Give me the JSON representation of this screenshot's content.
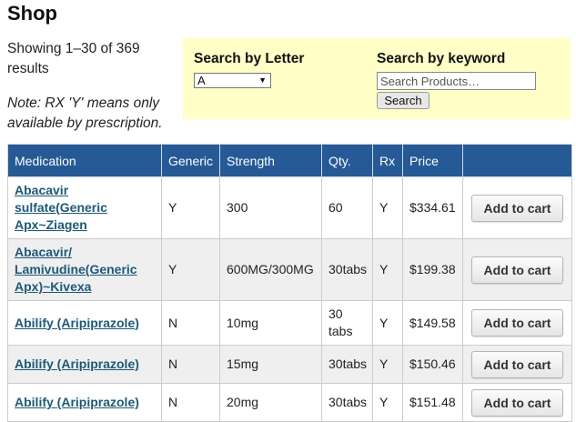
{
  "page": {
    "title": "Shop",
    "showing": "Showing 1–30 of 369 results",
    "note": "Note: RX 'Y' means only available by prescription."
  },
  "search": {
    "letter_label": "Search by Letter",
    "letter_value": "A",
    "keyword_label": "Search by keyword",
    "keyword_placeholder": "Search Products…",
    "button_label": "Search"
  },
  "table": {
    "headers": {
      "medication": "Medication",
      "generic": "Generic",
      "strength": "Strength",
      "qty": "Qty.",
      "rx": "Rx",
      "price": "Price"
    },
    "add_to_cart_label": "Add to cart",
    "rows": [
      {
        "medication": "Abacavir sulfate(Generic Apx~Ziagen",
        "generic": "Y",
        "strength": "300",
        "qty": "60",
        "rx": "Y",
        "price": "$334.61"
      },
      {
        "medication": "Abacavir/ Lamivudine(Generic Apx)~Kivexa",
        "generic": "Y",
        "strength": "600MG/300MG",
        "qty": "30tabs",
        "rx": "Y",
        "price": "$199.38"
      },
      {
        "medication": "Abilify (Aripiprazole)",
        "generic": "N",
        "strength": "10mg",
        "qty": "30 tabs",
        "rx": "Y",
        "price": "$149.58"
      },
      {
        "medication": "Abilify (Aripiprazole)",
        "generic": "N",
        "strength": "15mg",
        "qty": "30tabs",
        "rx": "Y",
        "price": "$150.46"
      },
      {
        "medication": "Abilify (Aripiprazole)",
        "generic": "N",
        "strength": "20mg",
        "qty": "30tabs",
        "rx": "Y",
        "price": "$151.48"
      }
    ]
  },
  "colors": {
    "header_bg": "#255a96",
    "search_panel_bg": "#ffffc8",
    "link": "#1a5a7a"
  }
}
